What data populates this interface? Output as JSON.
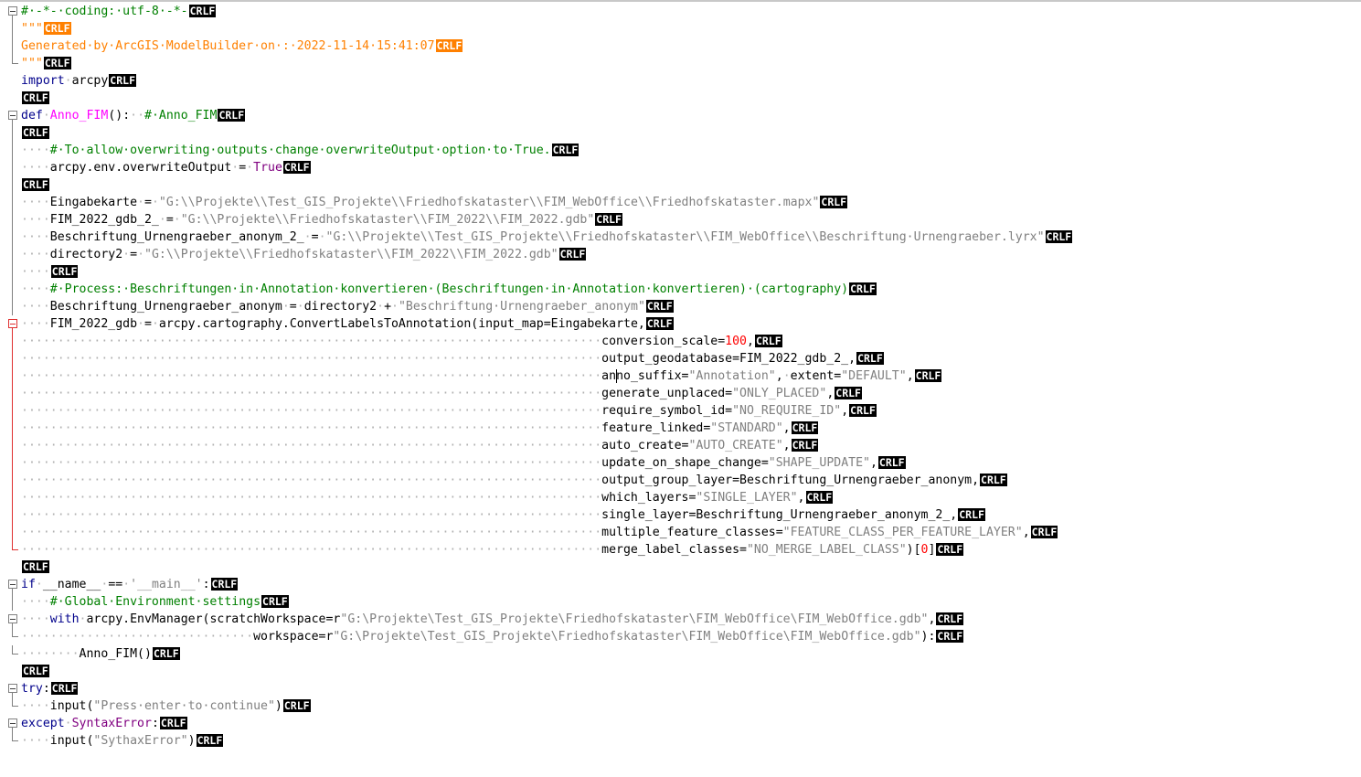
{
  "editor": {
    "eol_marker": "CRLF",
    "lines": [
      {
        "fold": "open",
        "tokens": [
          [
            "cm",
            "#·-*-·coding:·utf-8·-*-"
          ]
        ],
        "eol": "normal"
      },
      {
        "fold": "vline",
        "tokens": [
          [
            "gen",
            "\"\"\""
          ]
        ],
        "eol": "orange"
      },
      {
        "fold": "vline",
        "tokens": [
          [
            "gen",
            "Generated·by·ArcGIS·ModelBuilder·on·:·2022-11-14·15:41:07"
          ]
        ],
        "eol": "orange"
      },
      {
        "fold": "end",
        "tokens": [
          [
            "gen",
            "\"\"\""
          ]
        ],
        "eol": "normal"
      },
      {
        "fold": "none",
        "tokens": [
          [
            "kw",
            "import"
          ],
          [
            "ws",
            "·"
          ],
          [
            "t",
            "arcpy"
          ]
        ],
        "eol": "normal"
      },
      {
        "fold": "none",
        "tokens": [],
        "eol": "normal"
      },
      {
        "fold": "open",
        "tokens": [
          [
            "kw",
            "def"
          ],
          [
            "ws",
            "·"
          ],
          [
            "fn",
            "Anno_FIM"
          ],
          [
            "t",
            "():"
          ],
          [
            "ws",
            "··"
          ],
          [
            "cm",
            "#·Anno_FIM"
          ]
        ],
        "eol": "normal"
      },
      {
        "fold": "vline",
        "tokens": [],
        "eol": "normal"
      },
      {
        "fold": "vline",
        "tokens": [
          [
            "ws",
            "····"
          ],
          [
            "cm",
            "#·To·allow·overwriting·outputs·change·overwriteOutput·option·to·True."
          ]
        ],
        "eol": "normal"
      },
      {
        "fold": "vline",
        "tokens": [
          [
            "ws",
            "····"
          ],
          [
            "t",
            "arcpy.env.overwriteOutput"
          ],
          [
            "ws",
            "·"
          ],
          [
            "t",
            "="
          ],
          [
            "ws",
            "·"
          ],
          [
            "kw2",
            "True"
          ]
        ],
        "eol": "normal"
      },
      {
        "fold": "vline",
        "tokens": [],
        "eol": "normal"
      },
      {
        "fold": "vline",
        "tokens": [
          [
            "ws",
            "····"
          ],
          [
            "t",
            "Eingabekarte"
          ],
          [
            "ws",
            "·"
          ],
          [
            "t",
            "="
          ],
          [
            "ws",
            "·"
          ],
          [
            "str",
            "\"G:\\\\Projekte\\\\Test_GIS_Projekte\\\\Friedhofskataster\\\\FIM_WebOffice\\\\Friedhofskataster.mapx\""
          ]
        ],
        "eol": "normal"
      },
      {
        "fold": "vline",
        "tokens": [
          [
            "ws",
            "····"
          ],
          [
            "t",
            "FIM_2022_gdb_2_"
          ],
          [
            "ws",
            "·"
          ],
          [
            "t",
            "="
          ],
          [
            "ws",
            "·"
          ],
          [
            "str",
            "\"G:\\\\Projekte\\\\Friedhofskataster\\\\FIM_2022\\\\FIM_2022.gdb\""
          ]
        ],
        "eol": "normal"
      },
      {
        "fold": "vline",
        "tokens": [
          [
            "ws",
            "····"
          ],
          [
            "t",
            "Beschriftung_Urnengraeber_anonym_2_"
          ],
          [
            "ws",
            "·"
          ],
          [
            "t",
            "="
          ],
          [
            "ws",
            "·"
          ],
          [
            "str",
            "\"G:\\\\Projekte\\\\Test_GIS_Projekte\\\\Friedhofskataster\\\\FIM_WebOffice\\\\Beschriftung·Urnengraeber.lyrx\""
          ]
        ],
        "eol": "normal"
      },
      {
        "fold": "vline",
        "tokens": [
          [
            "ws",
            "····"
          ],
          [
            "t",
            "directory2"
          ],
          [
            "ws",
            "·"
          ],
          [
            "t",
            "="
          ],
          [
            "ws",
            "·"
          ],
          [
            "str",
            "\"G:\\\\Projekte\\\\Friedhofskataster\\\\FIM_2022\\\\FIM_2022.gdb\""
          ]
        ],
        "eol": "normal"
      },
      {
        "fold": "vline",
        "tokens": [
          [
            "ws",
            "····"
          ]
        ],
        "eol": "normal"
      },
      {
        "fold": "vline",
        "tokens": [
          [
            "ws",
            "····"
          ],
          [
            "cm",
            "#·Process:·Beschriftungen·in·Annotation·konvertieren·(Beschriftungen·in·Annotation·konvertieren)·(cartography)"
          ]
        ],
        "eol": "normal"
      },
      {
        "fold": "vline",
        "tokens": [
          [
            "ws",
            "····"
          ],
          [
            "t",
            "Beschriftung_Urnengraeber_anonym"
          ],
          [
            "ws",
            "·"
          ],
          [
            "t",
            "="
          ],
          [
            "ws",
            "·"
          ],
          [
            "t",
            "directory2"
          ],
          [
            "ws",
            "·"
          ],
          [
            "t",
            "+"
          ],
          [
            "ws",
            "·"
          ],
          [
            "str",
            "\"Beschriftung·Urnengraeber_anonym\""
          ]
        ],
        "eol": "normal"
      },
      {
        "fold": "open-red",
        "tokens": [
          [
            "ws",
            "····"
          ],
          [
            "t",
            "FIM_2022_gdb"
          ],
          [
            "ws",
            "·"
          ],
          [
            "t",
            "="
          ],
          [
            "ws",
            "·"
          ],
          [
            "t",
            "arcpy.cartography.ConvertLabelsToAnnotation(input_map=Eingabekarte,"
          ]
        ],
        "eol": "normal"
      },
      {
        "fold": "vline-red",
        "tokens": [
          [
            "ws",
            "················································································"
          ],
          [
            "t",
            "conversion_scale="
          ],
          [
            "num",
            "100"
          ],
          [
            "t",
            ","
          ]
        ],
        "eol": "normal"
      },
      {
        "fold": "vline-red",
        "tokens": [
          [
            "ws",
            "················································································"
          ],
          [
            "t",
            "output_geodatabase=FIM_2022_gdb_2_,"
          ]
        ],
        "eol": "normal"
      },
      {
        "fold": "vline-red",
        "hl": true,
        "tokens": [
          [
            "ws",
            "················································································"
          ],
          [
            "t",
            "an"
          ],
          [
            "caret",
            ""
          ],
          [
            "t",
            "no_suffix="
          ],
          [
            "str",
            "\"Annotation\""
          ],
          [
            "t",
            ","
          ],
          [
            "ws",
            "·"
          ],
          [
            "t",
            "extent="
          ],
          [
            "str",
            "\"DEFAULT\""
          ],
          [
            "t",
            ","
          ]
        ],
        "eol": "normal"
      },
      {
        "fold": "vline-red",
        "tokens": [
          [
            "ws",
            "················································································"
          ],
          [
            "t",
            "generate_unplaced="
          ],
          [
            "str",
            "\"ONLY_PLACED\""
          ],
          [
            "t",
            ","
          ]
        ],
        "eol": "normal"
      },
      {
        "fold": "vline-red",
        "tokens": [
          [
            "ws",
            "················································································"
          ],
          [
            "t",
            "require_symbol_id="
          ],
          [
            "str",
            "\"NO_REQUIRE_ID\""
          ],
          [
            "t",
            ","
          ]
        ],
        "eol": "normal"
      },
      {
        "fold": "vline-red",
        "tokens": [
          [
            "ws",
            "················································································"
          ],
          [
            "t",
            "feature_linked="
          ],
          [
            "str",
            "\"STANDARD\""
          ],
          [
            "t",
            ","
          ]
        ],
        "eol": "normal"
      },
      {
        "fold": "vline-red",
        "tokens": [
          [
            "ws",
            "················································································"
          ],
          [
            "t",
            "auto_create="
          ],
          [
            "str",
            "\"AUTO_CREATE\""
          ],
          [
            "t",
            ","
          ]
        ],
        "eol": "normal"
      },
      {
        "fold": "vline-red",
        "tokens": [
          [
            "ws",
            "················································································"
          ],
          [
            "t",
            "update_on_shape_change="
          ],
          [
            "str",
            "\"SHAPE_UPDATE\""
          ],
          [
            "t",
            ","
          ]
        ],
        "eol": "normal"
      },
      {
        "fold": "vline-red",
        "tokens": [
          [
            "ws",
            "················································································"
          ],
          [
            "t",
            "output_group_layer=Beschriftung_Urnengraeber_anonym,"
          ]
        ],
        "eol": "normal"
      },
      {
        "fold": "vline-red",
        "tokens": [
          [
            "ws",
            "················································································"
          ],
          [
            "t",
            "which_layers="
          ],
          [
            "str",
            "\"SINGLE_LAYER\""
          ],
          [
            "t",
            ","
          ]
        ],
        "eol": "normal"
      },
      {
        "fold": "vline-red",
        "tokens": [
          [
            "ws",
            "················································································"
          ],
          [
            "t",
            "single_layer=Beschriftung_Urnengraeber_anonym_2_,"
          ]
        ],
        "eol": "normal"
      },
      {
        "fold": "vline-red",
        "tokens": [
          [
            "ws",
            "················································································"
          ],
          [
            "t",
            "multiple_feature_classes="
          ],
          [
            "str",
            "\"FEATURE_CLASS_PER_FEATURE_LAYER\""
          ],
          [
            "t",
            ","
          ]
        ],
        "eol": "normal"
      },
      {
        "fold": "end-red",
        "tokens": [
          [
            "ws",
            "················································································"
          ],
          [
            "t",
            "merge_label_classes="
          ],
          [
            "str",
            "\"NO_MERGE_LABEL_CLASS\""
          ],
          [
            "t",
            ")["
          ],
          [
            "num",
            "0"
          ],
          [
            "t",
            "]"
          ]
        ],
        "eol": "normal"
      },
      {
        "fold": "none",
        "tokens": [],
        "eol": "normal"
      },
      {
        "fold": "open",
        "tokens": [
          [
            "kw",
            "if"
          ],
          [
            "ws",
            "·"
          ],
          [
            "t",
            "__name__"
          ],
          [
            "ws",
            "·"
          ],
          [
            "t",
            "=="
          ],
          [
            "ws",
            "·"
          ],
          [
            "str",
            "'__main__'"
          ],
          [
            "t",
            ":"
          ]
        ],
        "eol": "normal"
      },
      {
        "fold": "vline",
        "tokens": [
          [
            "ws",
            "····"
          ],
          [
            "cm",
            "#·Global·Environment·settings"
          ]
        ],
        "eol": "normal"
      },
      {
        "fold": "open",
        "tokens": [
          [
            "ws",
            "····"
          ],
          [
            "kw",
            "with"
          ],
          [
            "ws",
            "·"
          ],
          [
            "t",
            "arcpy.EnvManager(scratchWorkspace=r"
          ],
          [
            "str",
            "\"G:\\Projekte\\Test_GIS_Projekte\\Friedhofskataster\\FIM_WebOffice\\FIM_WebOffice.gdb\""
          ],
          [
            "t",
            ","
          ]
        ],
        "eol": "normal"
      },
      {
        "fold": "end",
        "tokens": [
          [
            "ws",
            "································"
          ],
          [
            "t",
            "workspace=r"
          ],
          [
            "str",
            "\"G:\\Projekte\\Test_GIS_Projekte\\Friedhofskataster\\FIM_WebOffice\\FIM_WebOffice.gdb\""
          ],
          [
            "t",
            "):"
          ]
        ],
        "eol": "normal"
      },
      {
        "fold": "end",
        "tokens": [
          [
            "ws",
            "········"
          ],
          [
            "t",
            "Anno_FIM()"
          ]
        ],
        "eol": "normal"
      },
      {
        "fold": "none",
        "tokens": [],
        "eol": "normal"
      },
      {
        "fold": "open",
        "tokens": [
          [
            "kw",
            "try"
          ],
          [
            "t",
            ":"
          ]
        ],
        "eol": "normal"
      },
      {
        "fold": "end",
        "tokens": [
          [
            "ws",
            "····"
          ],
          [
            "t",
            "input("
          ],
          [
            "str",
            "\"Press·enter·to·continue\""
          ],
          [
            "t",
            ")"
          ]
        ],
        "eol": "normal"
      },
      {
        "fold": "open",
        "tokens": [
          [
            "kw",
            "except"
          ],
          [
            "ws",
            "·"
          ],
          [
            "kw2",
            "SyntaxError"
          ],
          [
            "t",
            ":"
          ]
        ],
        "eol": "normal"
      },
      {
        "fold": "end",
        "tokens": [
          [
            "ws",
            "····"
          ],
          [
            "t",
            "input("
          ],
          [
            "str",
            "\"SythaxError\""
          ],
          [
            "t",
            ")"
          ]
        ],
        "eol": "normal"
      }
    ]
  }
}
